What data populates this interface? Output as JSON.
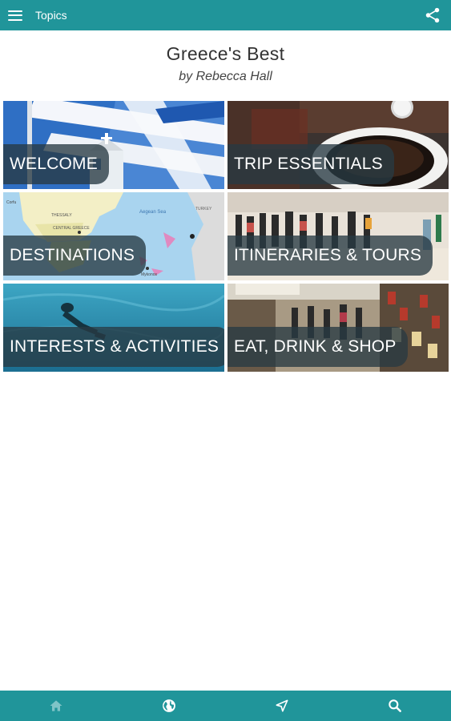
{
  "topbar": {
    "title": "Topics"
  },
  "header": {
    "title": "Greece's Best",
    "subtitle": "by Rebecca Hall"
  },
  "tiles": [
    {
      "label": "WELCOME"
    },
    {
      "label": "TRIP ESSENTIALS"
    },
    {
      "label": "DESTINATIONS"
    },
    {
      "label": "ITINERARIES & TOURS"
    },
    {
      "label": "INTERESTS & ACTIVITIES"
    },
    {
      "label": "EAT, DRINK & SHOP"
    }
  ],
  "map_labels": {
    "thessaly": "THESSALY",
    "central_greece": "CENTRAL GREECE",
    "aegean_sea": "Aegean Sea",
    "turkey": "TURKEY",
    "corfu": "Corfu",
    "mykonos": "Mykonos"
  },
  "colors": {
    "accent": "#20959a",
    "label_overlay": "#283a42"
  },
  "bottom_nav": [
    "home-icon",
    "globe-icon",
    "navigation-icon",
    "search-icon"
  ]
}
